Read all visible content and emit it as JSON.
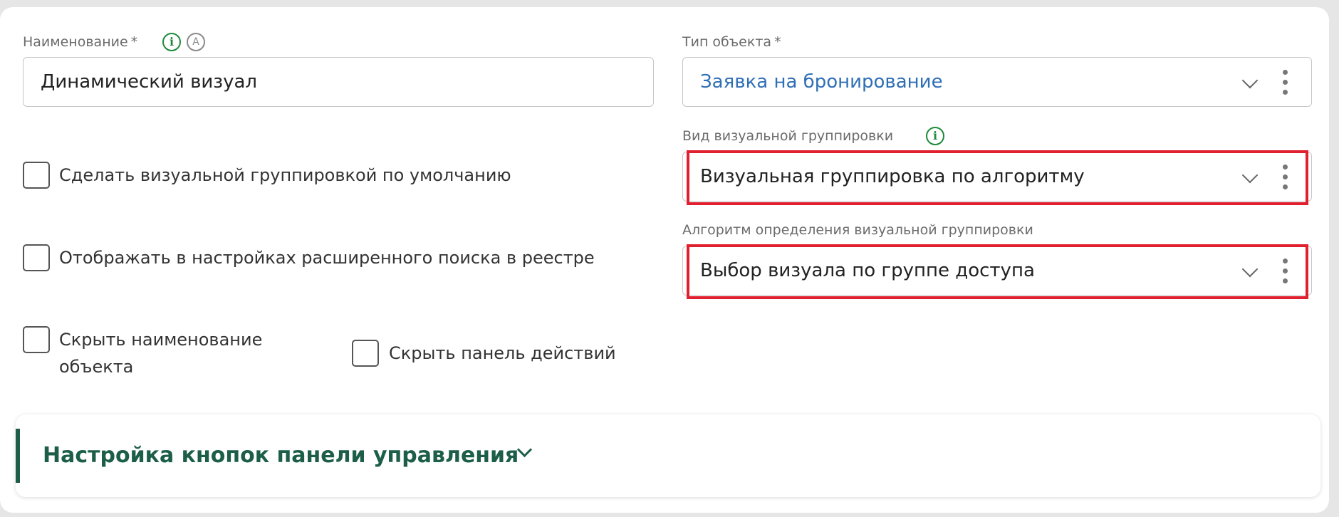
{
  "form": {
    "name_label": "Наименование",
    "required_mark": "*",
    "name_value": "Динамический визуал",
    "object_type_label": "Тип объекта",
    "object_type_value": "Заявка на бронирование",
    "grouping_kind_label": "Вид визуальной группировки",
    "grouping_kind_value": "Визуальная группировка по алгоритму",
    "algorithm_label": "Алгоритм определения визуальной группировки",
    "algorithm_value": "Выбор визуала по группе доступа"
  },
  "icons": {
    "info": "i",
    "auto": "A"
  },
  "checkboxes": {
    "default_grouping": "Сделать визуальной группировкой по умолчанию",
    "show_in_advanced_search": "Отображать в настройках расширенного поиска в реестре",
    "hide_object_name_line1": "Скрыть наименование",
    "hide_object_name_line2": "объекта",
    "hide_action_panel": "Скрыть панель действий"
  },
  "section": {
    "title": "Настройка кнопок панели управления"
  },
  "colors": {
    "accent_green": "#1d5e48",
    "info_green": "#1e8a3a",
    "link_blue": "#2f6fb5",
    "highlight_red": "#e0202e"
  }
}
